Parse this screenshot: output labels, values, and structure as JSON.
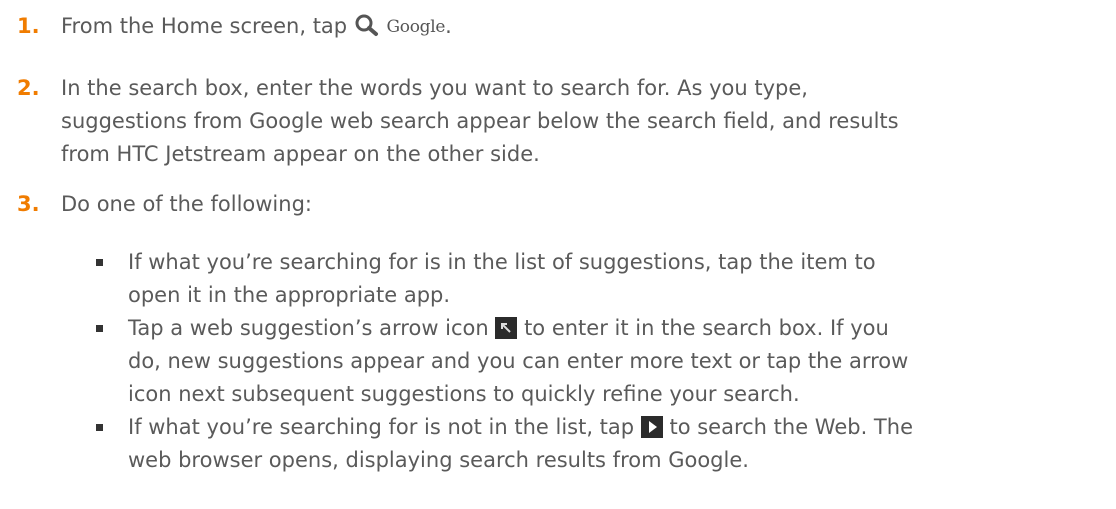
{
  "steps": [
    {
      "number": "1.",
      "text_before": "From the Home screen, tap ",
      "icon_label": "Google",
      "text_after": "."
    },
    {
      "number": "2.",
      "line1": "In the search box, enter the words you want to search for. As you type,",
      "line2": "suggestions from Google web search appear below the search field, and results",
      "line3": "from HTC Jetstream appear on the other side."
    },
    {
      "number": "3.",
      "text": "Do one of the following:"
    }
  ],
  "bullets": [
    {
      "line1": "If what you’re searching for is in the list of suggestions, tap the item to",
      "line2": "open it in the appropriate app."
    },
    {
      "line1_before": "Tap a web suggestion’s arrow icon ",
      "line1_after": " to enter it in the search box. If you",
      "line2": "do, new suggestions appear and you can enter more text or tap the arrow",
      "line3": "icon next subsequent suggestions to quickly refine your search."
    },
    {
      "line1_before": "If what you’re searching for is not in the list, tap ",
      "line1_after": " to search the Web. The",
      "line2": "web browser opens, displaying search results from Google."
    }
  ],
  "icons": {
    "search": "search-icon",
    "arrow": "arrow-up-left-icon",
    "go": "play-arrow-icon"
  },
  "colors": {
    "step_number": "#f07c00",
    "body_text": "#5a5a5a",
    "icon_bg": "#2b2b2b"
  }
}
